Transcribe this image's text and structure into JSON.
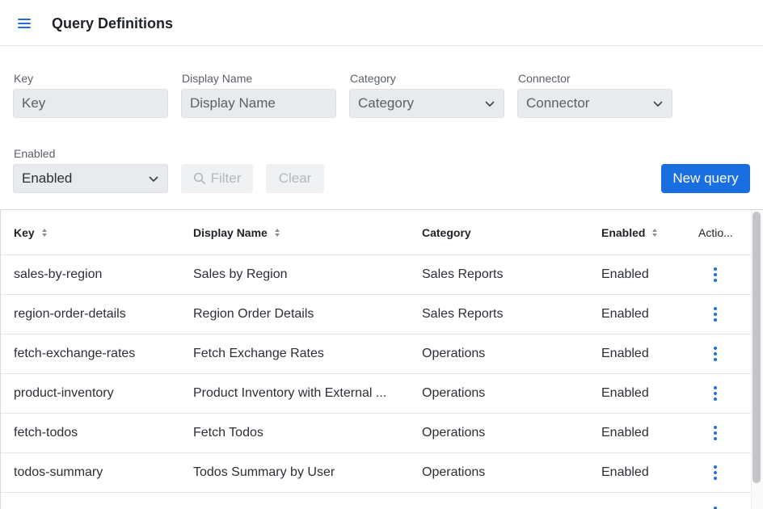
{
  "header": {
    "title": "Query Definitions",
    "menu_icon": "hamburger-menu-icon"
  },
  "filters": {
    "key": {
      "label": "Key",
      "placeholder": "Key"
    },
    "display_name": {
      "label": "Display Name",
      "placeholder": "Display Name"
    },
    "category": {
      "label": "Category",
      "value": "Category"
    },
    "connector": {
      "label": "Connector",
      "value": "Connector"
    },
    "enabled": {
      "label": "Enabled",
      "value": "Enabled"
    },
    "filter_button": "Filter",
    "clear_button": "Clear",
    "new_query_button": "New query"
  },
  "table": {
    "columns": [
      "Key",
      "Display Name",
      "Category",
      "Enabled",
      "Actio..."
    ],
    "rows": [
      {
        "key": "sales-by-region",
        "display_name": "Sales by Region",
        "category": "Sales Reports",
        "enabled": "Enabled"
      },
      {
        "key": "region-order-details",
        "display_name": "Region Order Details",
        "category": "Sales Reports",
        "enabled": "Enabled"
      },
      {
        "key": "fetch-exchange-rates",
        "display_name": "Fetch Exchange Rates",
        "category": "Operations",
        "enabled": "Enabled"
      },
      {
        "key": "product-inventory",
        "display_name": "Product Inventory with External ...",
        "category": "Operations",
        "enabled": "Enabled"
      },
      {
        "key": "fetch-todos",
        "display_name": "Fetch Todos",
        "category": "Operations",
        "enabled": "Enabled"
      },
      {
        "key": "todos-summary",
        "display_name": "Todos Summary by User",
        "category": "Operations",
        "enabled": "Enabled"
      }
    ]
  },
  "colors": {
    "accent": "#1a6fe0",
    "input_bg": "#e8eaed",
    "border": "#e3e5e8"
  }
}
